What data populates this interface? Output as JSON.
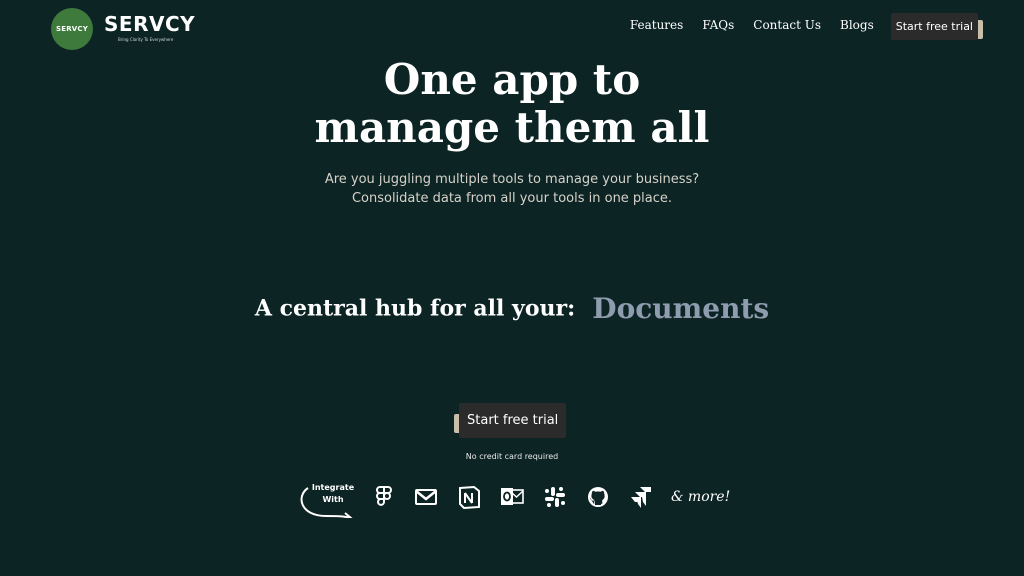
{
  "brand": {
    "badge_text": "SERVCY",
    "name": "SERVCY",
    "tagline": "Bring Clarity To Everywhere",
    "badge_color": "#3f7a3d"
  },
  "nav": {
    "links": [
      "Features",
      "FAQs",
      "Contact Us",
      "Blogs"
    ],
    "cta_label": "Start free trial"
  },
  "hero": {
    "title_line1": "One app to",
    "title_line2": "manage them all",
    "subtitle_line1": "Are you juggling multiple tools to manage your business?",
    "subtitle_line2": "Consolidate data from all your tools in one place."
  },
  "hub": {
    "label": "A central hub for all your:",
    "rotating_word": "Documents"
  },
  "cta": {
    "label": "Start free trial",
    "note": "No credit card required"
  },
  "integrations": {
    "label_line1": "Integrate",
    "label_line2": "With",
    "icons": [
      "figma-icon",
      "gmail-icon",
      "notion-icon",
      "outlook-icon",
      "slack-icon",
      "github-icon",
      "jira-icon"
    ],
    "more_label": "& more!"
  },
  "colors": {
    "background": "#0d2424",
    "button": "#2b2b2b",
    "button_shadow": "#c9bfa8",
    "accent_word": "#8f9cb0"
  }
}
